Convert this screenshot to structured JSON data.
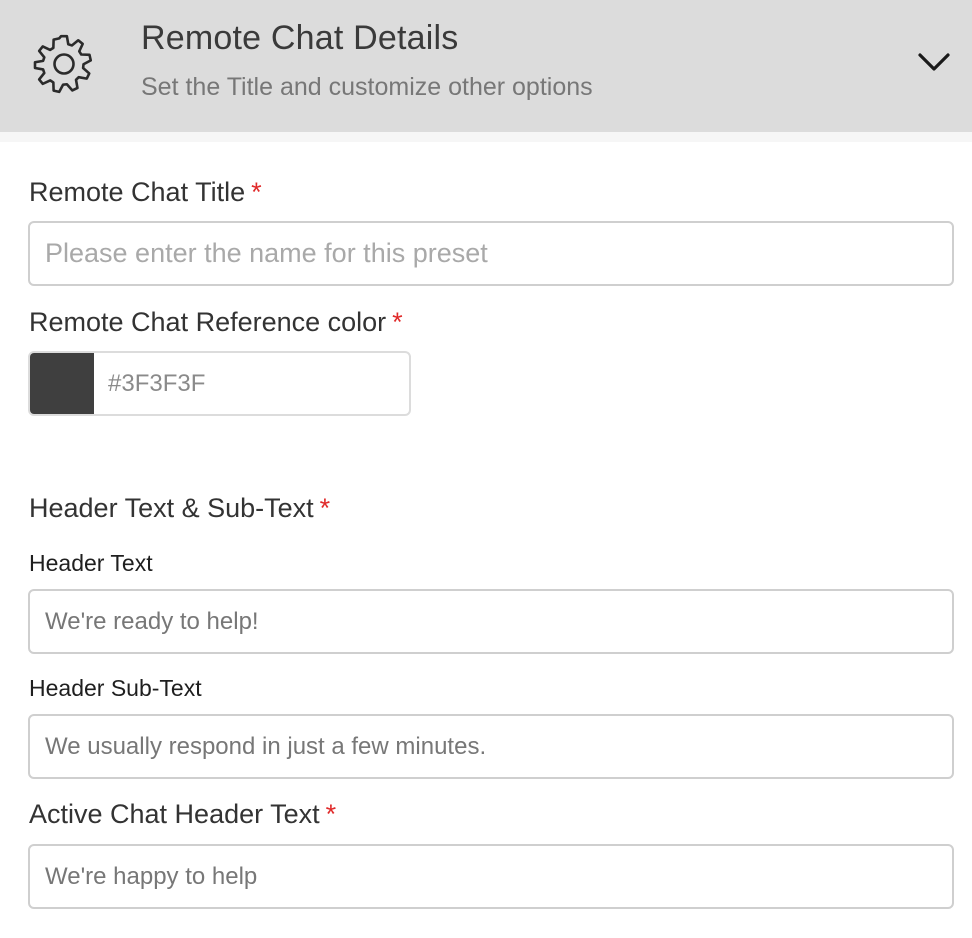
{
  "colors": {
    "header_bg": "#dcdcdc",
    "required_marker": "#e02a2a",
    "reference_swatch": "#3F3F3F"
  },
  "header": {
    "icon": "gear-icon",
    "title": "Remote Chat Details",
    "subtitle": "Set the Title and customize other options",
    "toggle_icon": "chevron-down-icon"
  },
  "form": {
    "title_field": {
      "label": "Remote Chat Title",
      "required_marker": "*",
      "value": "",
      "placeholder": "Please enter the name for this preset"
    },
    "color_field": {
      "label": "Remote Chat Reference color",
      "required_marker": "*",
      "value": "#3F3F3F"
    },
    "header_section": {
      "label": "Header Text & Sub-Text",
      "required_marker": "*",
      "header_text": {
        "label": "Header Text",
        "value": "We're ready to help!"
      },
      "header_subtext": {
        "label": "Header Sub-Text",
        "value": "We usually respond in just a few minutes."
      }
    },
    "active_chat_field": {
      "label": "Active Chat Header Text",
      "required_marker": "*",
      "value": "We're happy to help"
    }
  }
}
